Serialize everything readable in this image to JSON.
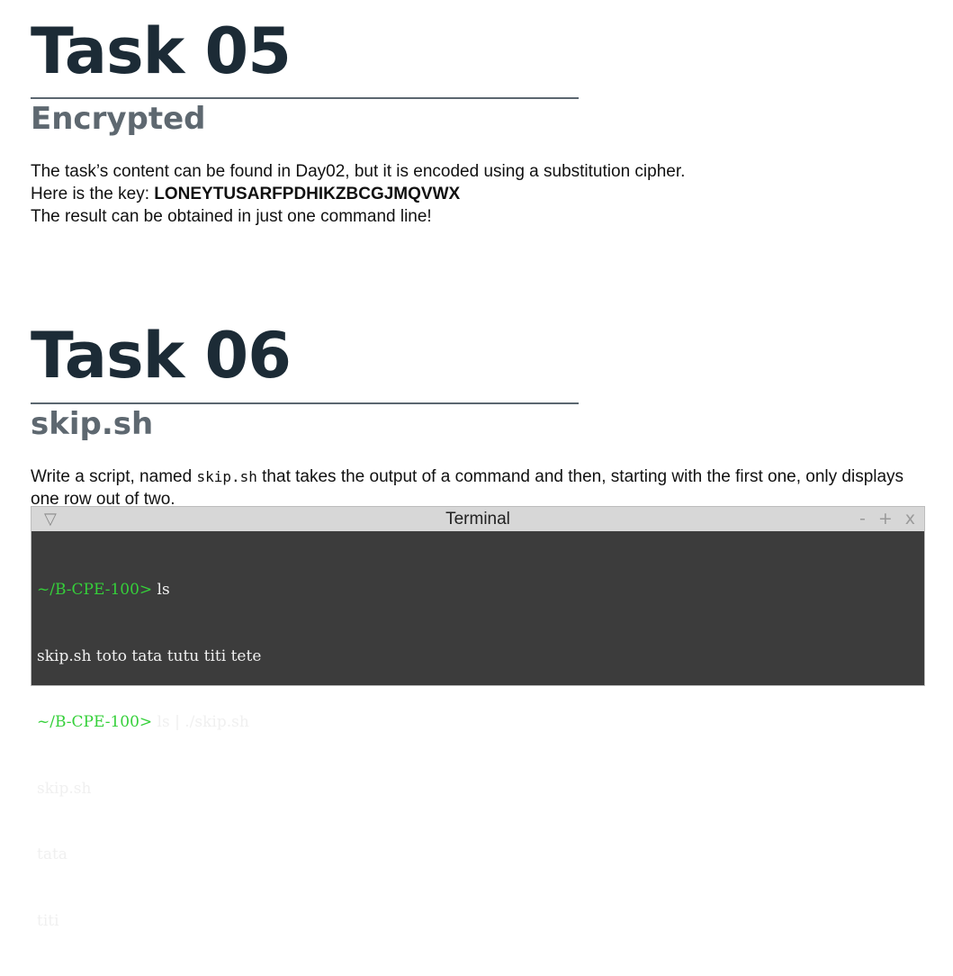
{
  "task05": {
    "title": "Task 05",
    "subtitle": "Encrypted",
    "line1": "The task’s content can be found in Day02, but it is encoded using a substitution cipher.",
    "key_prefix": "Here is the key: ",
    "key": "LONEYTUSARFPDHIKZBCGJMQVWX",
    "line3": "The result can be obtained in just one command line!"
  },
  "task06": {
    "title": "Task 06",
    "subtitle": "skip.sh",
    "desc_prefix": "Write a script, named ",
    "desc_code": "skip.sh",
    "desc_suffix": " that takes the output of a command and then, starting with the first one, only displays one row out of two."
  },
  "terminal": {
    "title": "Terminal",
    "menu_icon": "▽",
    "minimize_label": "-",
    "maximize_label": "+",
    "close_label": "x",
    "lines": [
      {
        "prompt": "~/B-CPE-100> ",
        "text": "ls"
      },
      {
        "prompt": "",
        "text": "skip.sh toto tata tutu titi tete"
      },
      {
        "prompt": "~/B-CPE-100> ",
        "text": "ls | ./skip.sh"
      },
      {
        "prompt": "",
        "text": "skip.sh"
      },
      {
        "prompt": "",
        "text": "tata"
      },
      {
        "prompt": "",
        "text": "titi"
      }
    ]
  }
}
